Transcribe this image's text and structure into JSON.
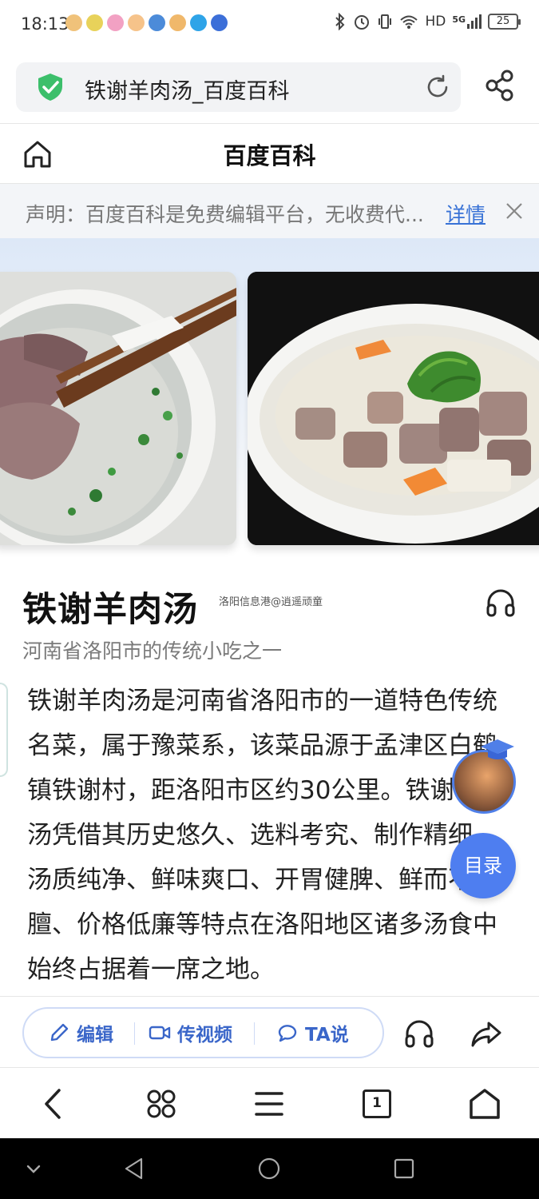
{
  "status_bar": {
    "time": "18:13",
    "apps": [
      "app-icon-1",
      "app-icon-2",
      "app-icon-3",
      "app-icon-4",
      "app-icon-5",
      "app-icon-6",
      "app-icon-7",
      "app-icon-8"
    ],
    "network": "HD",
    "signal": "5G",
    "battery": "25"
  },
  "url_bar": {
    "title": "铁谢羊肉汤_百度百科"
  },
  "site_header": {
    "title": "百度百科"
  },
  "notice": {
    "text": "声明：百度百科是免费编辑平台，无收费代...",
    "link": "详情"
  },
  "article": {
    "title": "铁谢羊肉汤",
    "watermark": "洛阳信息港@逍遥顽童",
    "subtitle": "河南省洛阳市的传统小吃之一",
    "body": "铁谢羊肉汤是河南省洛阳市的一道特色传统名菜，属于豫菜系，该菜品源于孟津区白鹤镇铁谢村，距洛阳市区约30公里。铁谢羊肉汤凭借其历史悠久、选料考究、制作精细、汤质纯净、鲜味爽口、开胃健脾、鲜而不膻、价格低廉等特点在洛阳地区诸多汤食中始终占据着一席之地。"
  },
  "floating": {
    "toc_label": "目录"
  },
  "action_bar": {
    "edit_label": "编辑",
    "video_label": "传视频",
    "ta_label": "TA说"
  },
  "browser_nav": {
    "tab_count": "1"
  },
  "colors": {
    "accent": "#3a66c9",
    "toc_button": "#4e7ef0",
    "notice_bg": "#f3f5f8",
    "link": "#3872d6"
  }
}
